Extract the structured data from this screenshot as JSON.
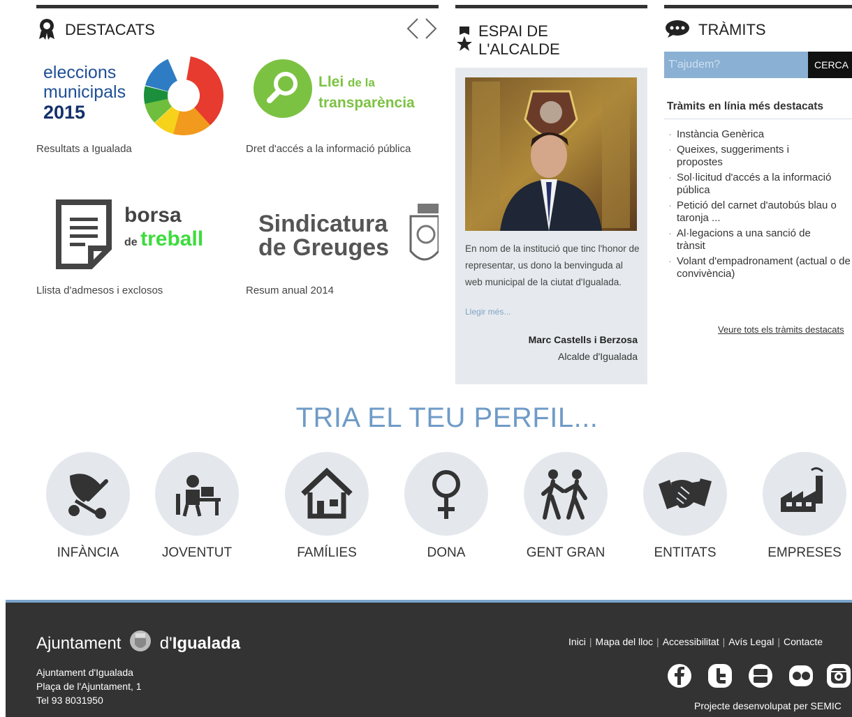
{
  "destacats": {
    "title": "DESTACATS",
    "items": [
      {
        "logo_line1": "eleccions",
        "logo_line2": "municipals",
        "logo_line3": "2015",
        "caption": "Resultats a Igualada"
      },
      {
        "logo_word1": "Llei",
        "logo_word2": "de la",
        "logo_word3": "transparència",
        "caption": "Dret d'accés a la informació pública"
      },
      {
        "logo_word1": "borsa",
        "logo_word2": "de",
        "logo_word3": "treball",
        "caption": "Llista d'admesos i exclosos"
      },
      {
        "logo_line1": "Sindicatura",
        "logo_line2": "de Greuges",
        "caption": "Resum anual 2014"
      }
    ]
  },
  "alcalde": {
    "title_line1": "ESPAI DE",
    "title_line2": "L'ALCALDE",
    "text": "En nom de la institució que tinc l'honor de representar, us dono la benvinguda al web municipal de la ciutat d'Igualada.",
    "more": "Llegir més...",
    "name": "Marc Castells i Berzosa",
    "role": "Alcalde d'Igualada"
  },
  "tramits": {
    "title": "TRÀMITS",
    "search_placeholder": "T'ajudem?",
    "search_button": "CERCA",
    "heading": "Tràmits en línia més destacats",
    "items": [
      "Instància Genèrica",
      "Queixes, suggeriments i propostes",
      "Sol·licitud d'accés a la informació pública",
      "Petició del carnet d'autobús blau o taronja ...",
      "Al·legacions a una sanció de trànsit",
      "Volant d'empadronament (actual o de convivència)"
    ],
    "see_all": "Veure tots els tràmits destacats"
  },
  "perfils": {
    "title": "TRIA EL TEU PERFIL...",
    "items": [
      {
        "label": "INFÀNCIA",
        "icon": "stroller-icon"
      },
      {
        "label": "JOVENTUT",
        "icon": "student-desk-icon"
      },
      {
        "label": "FAMÍLIES",
        "icon": "house-icon"
      },
      {
        "label": "DONA",
        "icon": "female-symbol-icon"
      },
      {
        "label": "GENT GRAN",
        "icon": "elderly-couple-icon"
      },
      {
        "label": "ENTITATS",
        "icon": "handshake-icon"
      },
      {
        "label": "EMPRESES",
        "icon": "factory-icon"
      }
    ]
  },
  "footer": {
    "logo_left": "Ajuntament",
    "logo_right_prefix": "d'",
    "logo_right_bold": "Igualada",
    "address_line1": "Ajuntament d'Igualada",
    "address_line2": "Plaça de l'Ajuntament, 1",
    "address_line3": "Tel 93 8031950",
    "links": [
      "Inici",
      "Mapa del lloc",
      "Accessibilitat",
      "Avís Legal",
      "Contacte"
    ],
    "credit": "Projecte desenvolupat per SEMIC"
  },
  "colors": {
    "accent_blue": "#6f9bc7",
    "search_blue": "#8ab0d3",
    "footer_bg": "#333333",
    "llei_green": "#7cc242",
    "treball_green": "#3ddc3d"
  }
}
